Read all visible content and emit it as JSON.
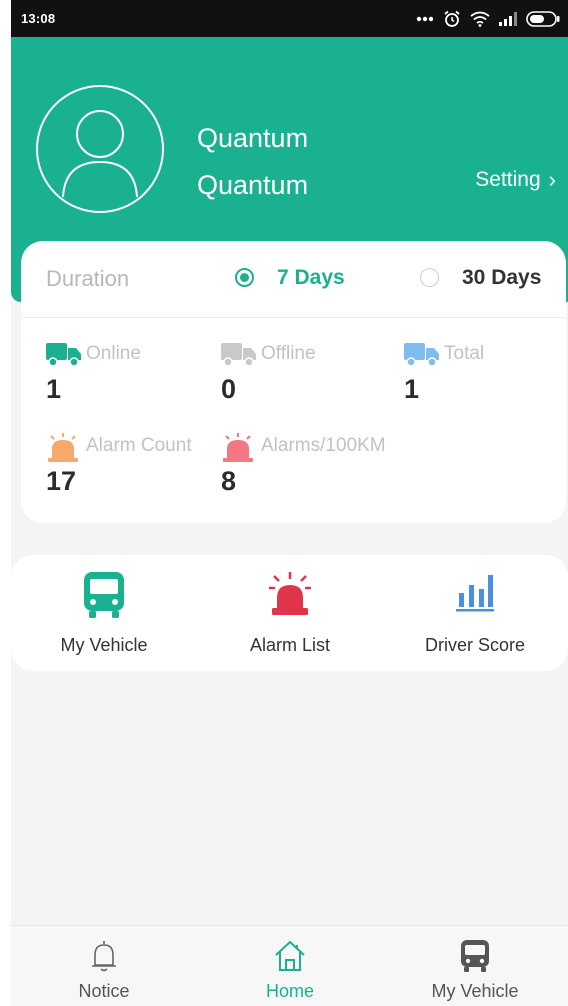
{
  "status_bar": {
    "time": "13:08"
  },
  "profile": {
    "name_line1": "Quantum",
    "name_line2": "Quantum",
    "setting_label": "Setting",
    "setting_chevron": "›"
  },
  "duration": {
    "label": "Duration",
    "options": [
      {
        "label": "7 Days",
        "selected": true
      },
      {
        "label": "30 Days",
        "selected": false
      }
    ]
  },
  "stats": [
    {
      "label": "Online",
      "value": "1",
      "icon": "truck-icon",
      "color": "#1ab191"
    },
    {
      "label": "Offline",
      "value": "0",
      "icon": "truck-icon",
      "color": "#c9c9c9"
    },
    {
      "label": "Total",
      "value": "1",
      "icon": "truck-icon",
      "color": "#7fbdf0"
    },
    {
      "label": "Alarm Count",
      "value": "17",
      "icon": "siren-icon",
      "color": "#f7a86b"
    },
    {
      "label": "Alarms/100KM",
      "value": "8",
      "icon": "siren-icon",
      "color": "#f27884"
    }
  ],
  "quick_actions": [
    {
      "label": "My Vehicle",
      "icon": "bus-icon",
      "color": "#1ab191"
    },
    {
      "label": "Alarm List",
      "icon": "alarm-light-icon",
      "color": "#e0344a"
    },
    {
      "label": "Driver Score",
      "icon": "bar-chart-icon",
      "color": "#4a8fe0"
    }
  ],
  "tabs": [
    {
      "label": "Notice",
      "icon": "bell-icon",
      "active": false
    },
    {
      "label": "Home",
      "icon": "home-icon",
      "active": true
    },
    {
      "label": "My Vehicle",
      "icon": "bus-icon",
      "active": false
    }
  ],
  "colors": {
    "accent": "#1ab191",
    "text_dark": "#2b2b2b",
    "muted": "#c2c2c2"
  }
}
